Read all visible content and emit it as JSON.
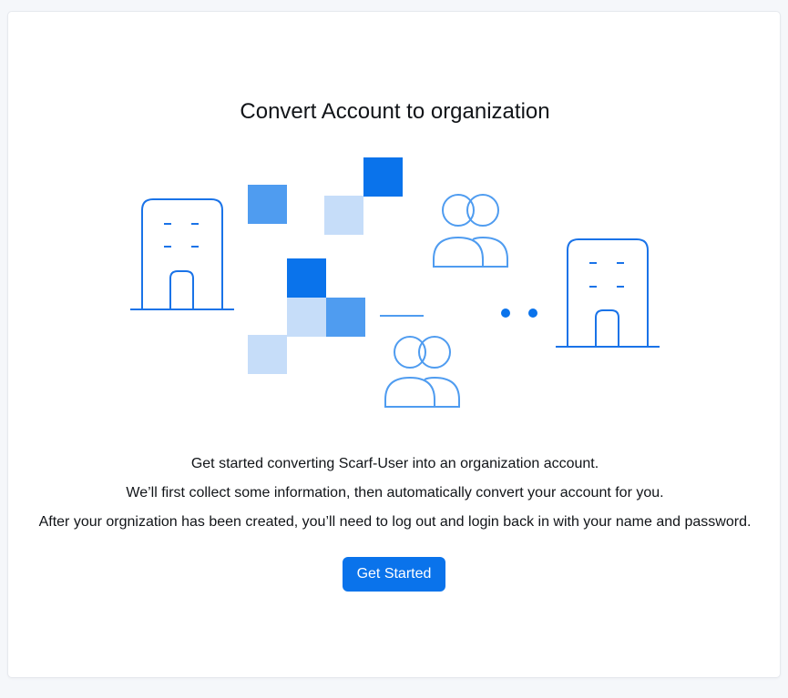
{
  "page": {
    "title": "Convert Account to organization",
    "description": [
      "Get started converting Scarf-User into an organization account.",
      "We’ll first collect some information, then automatically convert your account for you.",
      "After your orgnization has been created, you’ll need to log out and login back in with your name and password."
    ],
    "button_label": "Get Started"
  },
  "colors": {
    "accent": "#0a73eb",
    "accent_medium": "#4f9cf0",
    "accent_light": "#c6ddf9",
    "line": "#1a73e8"
  },
  "icons": [
    "building-icon",
    "blocks-icon",
    "users-icon",
    "dots-icon"
  ]
}
